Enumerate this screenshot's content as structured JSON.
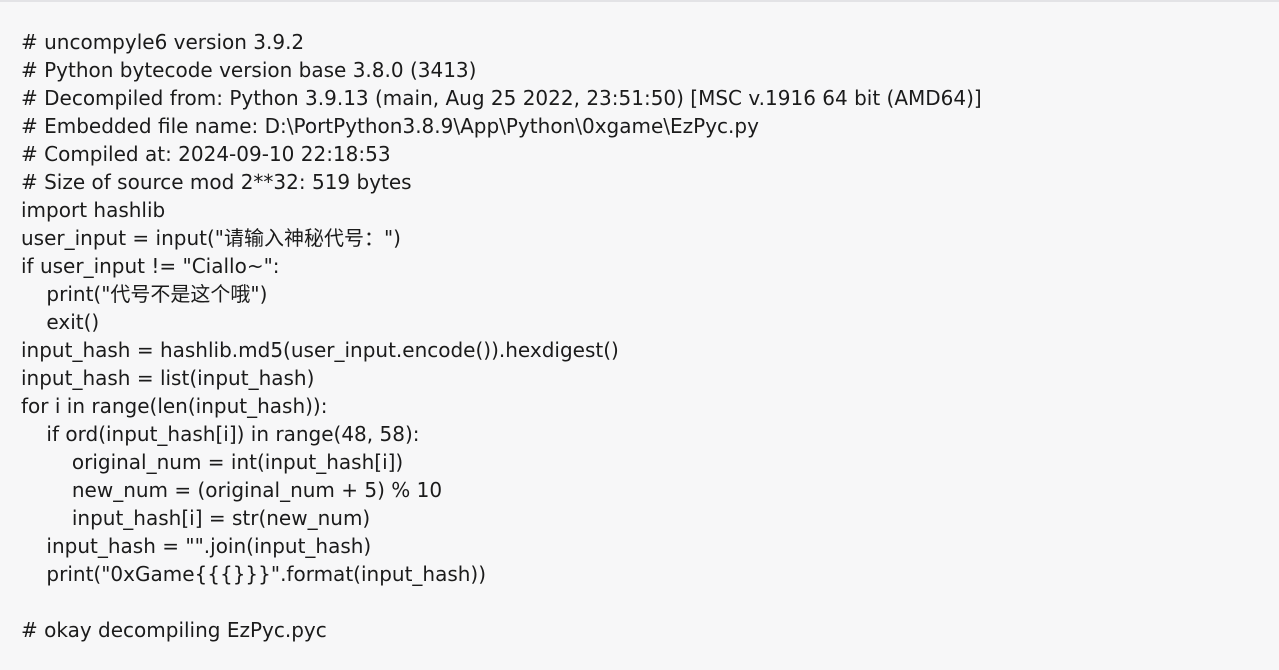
{
  "code": {
    "lines": [
      "# uncompyle6 version 3.9.2",
      "# Python bytecode version base 3.8.0 (3413)",
      "# Decompiled from: Python 3.9.13 (main, Aug 25 2022, 23:51:50) [MSC v.1916 64 bit (AMD64)]",
      "# Embedded file name: D:\\PortPython3.8.9\\App\\Python\\0xgame\\EzPyc.py",
      "# Compiled at: 2024-09-10 22:18:53",
      "# Size of source mod 2**32: 519 bytes",
      "import hashlib",
      "user_input = input(\"请输入神秘代号：\")",
      "if user_input != \"Ciallo~\":",
      "    print(\"代号不是这个哦\")",
      "    exit()",
      "input_hash = hashlib.md5(user_input.encode()).hexdigest()",
      "input_hash = list(input_hash)",
      "for i in range(len(input_hash)):",
      "    if ord(input_hash[i]) in range(48, 58):",
      "        original_num = int(input_hash[i])",
      "        new_num = (original_num + 5) % 10",
      "        input_hash[i] = str(new_num)",
      "    input_hash = \"\".join(input_hash)",
      "    print(\"0xGame{{{}}}\".format(input_hash))",
      "",
      "# okay decompiling EzPyc.pyc"
    ]
  }
}
